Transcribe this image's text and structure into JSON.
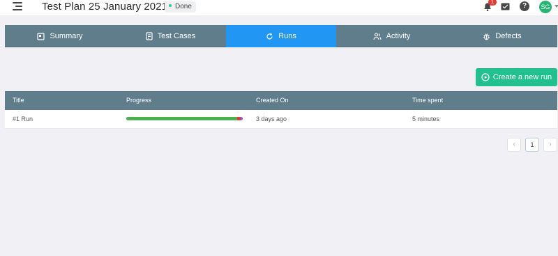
{
  "header": {
    "title": "Test Plan 25 January 2021",
    "status": "Done",
    "status_color": "#3cc48f",
    "notification_count": "1",
    "avatar_initials": "SG",
    "icons": [
      "menu-icon",
      "bell-icon",
      "inbox-icon",
      "help-icon"
    ]
  },
  "tabs": [
    {
      "label": "Summary",
      "icon": "summary-icon",
      "active": false
    },
    {
      "label": "Test Cases",
      "icon": "test-cases-icon",
      "active": false
    },
    {
      "label": "Runs",
      "icon": "refresh-icon",
      "active": true
    },
    {
      "label": "Activity",
      "icon": "activity-icon",
      "active": false
    },
    {
      "label": "Defects",
      "icon": "bug-icon",
      "active": false
    }
  ],
  "actions": {
    "create_run_label": "Create a new run"
  },
  "table": {
    "columns": [
      "Title",
      "Progress",
      "Created On",
      "Time spent"
    ],
    "rows": [
      {
        "title": "#1 Run",
        "progress": {
          "passed": 0.95,
          "failed": 0.03,
          "skipped": 0.02
        },
        "created_on": "3 days ago",
        "time_spent": "5 minutes"
      }
    ]
  },
  "pagination": {
    "current_page": "1",
    "prev_label": "‹",
    "next_label": "›"
  },
  "colors": {
    "tab_bar": "#607d8b",
    "tab_active": "#2196f3",
    "primary_action": "#22c08e",
    "progress_passed": "#4caf50",
    "progress_failed": "#e53935",
    "progress_skipped": "#7b61ff"
  }
}
